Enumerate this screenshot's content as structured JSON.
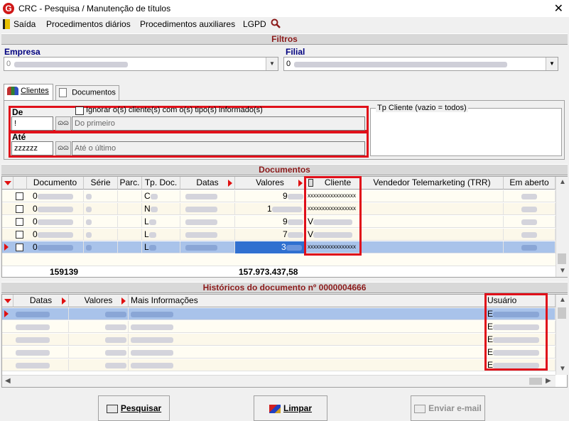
{
  "window": {
    "title": "CRC - Pesquisa / Manutenção de títulos",
    "close": "✕"
  },
  "menu": {
    "exit": "Saída",
    "daily": "Procedimentos diários",
    "aux": "Procedimentos auxiliares",
    "lgpd": "LGPD"
  },
  "filters": {
    "header": "Filtros",
    "empresa_label": "Empresa",
    "empresa_value": "0",
    "filial_label": "Filial",
    "filial_value": "0",
    "tabs": [
      "Clientes",
      "Documentos"
    ],
    "de_label": "De",
    "de_value": "!",
    "de_placeholder": "Do primeiro",
    "ignore_label": "Ignorar o(s) cliente(s) com o(s) tipo(s) informado(s)",
    "ate_label": "Até",
    "ate_value": "zzzzzz",
    "ate_placeholder": "Até o último",
    "tp_cliente_label": "Tp Cliente (vazio = todos)"
  },
  "documents": {
    "header": "Documentos",
    "columns": [
      "Documento",
      "Série",
      "Parc.",
      "Tp. Doc.",
      "Datas",
      "Valores",
      "Cliente",
      "Vendedor Telemarketing (TRR)",
      "Em aberto"
    ],
    "rows": [
      {
        "doc": "0",
        "tp": "C",
        "valor": "9",
        "cliente": "xxxxxxxxxxxxxxxxx"
      },
      {
        "doc": "0",
        "tp": "N",
        "valor": "1",
        "cliente": "xxxxxxxxxxxxxxxxx"
      },
      {
        "doc": "0",
        "tp": "L",
        "valor": "9",
        "cliente": "V"
      },
      {
        "doc": "0",
        "tp": "L",
        "valor": "7",
        "cliente": "V"
      },
      {
        "doc": "0",
        "tp": "L",
        "valor": "3",
        "cliente": "xxxxxxxxxxxxxxxxx"
      }
    ],
    "total_docs": "159139",
    "total_valores": "157.973.437,58"
  },
  "history": {
    "header": "Históricos do documento nº 0000004666",
    "columns": [
      "Datas",
      "Valores",
      "Mais Informações",
      "Usuário"
    ],
    "rows": [
      {
        "usuario": "E"
      },
      {
        "usuario": "E"
      },
      {
        "usuario": "E"
      },
      {
        "usuario": "E"
      },
      {
        "usuario": "E"
      }
    ]
  },
  "buttons": {
    "search": "Pesquisar",
    "clear": "Limpar",
    "email": "Enviar e-mail"
  }
}
